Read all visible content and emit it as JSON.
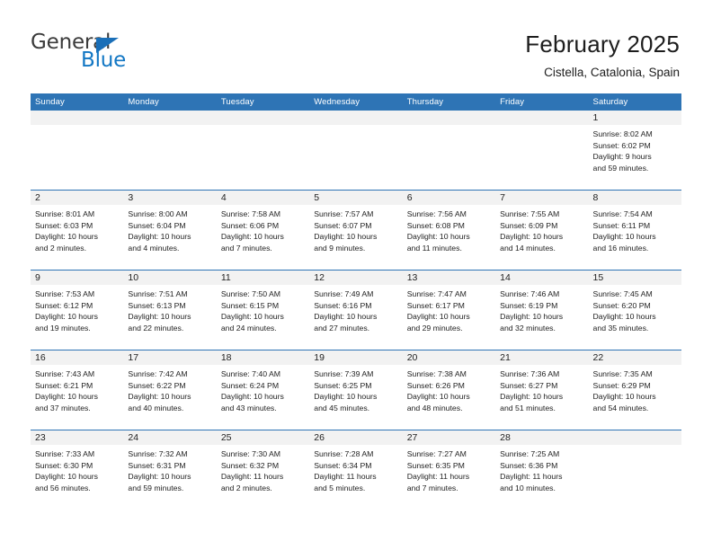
{
  "brand": {
    "name_part1": "General",
    "name_part2": "Blue",
    "triangle_color": "#1a6fb8",
    "blue_color": "#1277c4"
  },
  "header": {
    "title": "February 2025",
    "subtitle": "Cistella, Catalonia, Spain"
  },
  "theme": {
    "header_blue": "#2e74b5",
    "day_band_gray": "#f2f2f2",
    "text_color": "#222222"
  },
  "weekdays": [
    "Sunday",
    "Monday",
    "Tuesday",
    "Wednesday",
    "Thursday",
    "Friday",
    "Saturday"
  ],
  "weeks": [
    {
      "days": [
        {
          "number": "",
          "sunrise": "",
          "sunset": "",
          "daylight_line1": "",
          "daylight_line2": "",
          "empty": true
        },
        {
          "number": "",
          "sunrise": "",
          "sunset": "",
          "daylight_line1": "",
          "daylight_line2": "",
          "empty": true
        },
        {
          "number": "",
          "sunrise": "",
          "sunset": "",
          "daylight_line1": "",
          "daylight_line2": "",
          "empty": true
        },
        {
          "number": "",
          "sunrise": "",
          "sunset": "",
          "daylight_line1": "",
          "daylight_line2": "",
          "empty": true
        },
        {
          "number": "",
          "sunrise": "",
          "sunset": "",
          "daylight_line1": "",
          "daylight_line2": "",
          "empty": true
        },
        {
          "number": "",
          "sunrise": "",
          "sunset": "",
          "daylight_line1": "",
          "daylight_line2": "",
          "empty": true
        },
        {
          "number": "1",
          "sunrise": "Sunrise: 8:02 AM",
          "sunset": "Sunset: 6:02 PM",
          "daylight_line1": "Daylight: 9 hours",
          "daylight_line2": "and 59 minutes.",
          "empty": false
        }
      ]
    },
    {
      "days": [
        {
          "number": "2",
          "sunrise": "Sunrise: 8:01 AM",
          "sunset": "Sunset: 6:03 PM",
          "daylight_line1": "Daylight: 10 hours",
          "daylight_line2": "and 2 minutes.",
          "empty": false
        },
        {
          "number": "3",
          "sunrise": "Sunrise: 8:00 AM",
          "sunset": "Sunset: 6:04 PM",
          "daylight_line1": "Daylight: 10 hours",
          "daylight_line2": "and 4 minutes.",
          "empty": false
        },
        {
          "number": "4",
          "sunrise": "Sunrise: 7:58 AM",
          "sunset": "Sunset: 6:06 PM",
          "daylight_line1": "Daylight: 10 hours",
          "daylight_line2": "and 7 minutes.",
          "empty": false
        },
        {
          "number": "5",
          "sunrise": "Sunrise: 7:57 AM",
          "sunset": "Sunset: 6:07 PM",
          "daylight_line1": "Daylight: 10 hours",
          "daylight_line2": "and 9 minutes.",
          "empty": false
        },
        {
          "number": "6",
          "sunrise": "Sunrise: 7:56 AM",
          "sunset": "Sunset: 6:08 PM",
          "daylight_line1": "Daylight: 10 hours",
          "daylight_line2": "and 11 minutes.",
          "empty": false
        },
        {
          "number": "7",
          "sunrise": "Sunrise: 7:55 AM",
          "sunset": "Sunset: 6:09 PM",
          "daylight_line1": "Daylight: 10 hours",
          "daylight_line2": "and 14 minutes.",
          "empty": false
        },
        {
          "number": "8",
          "sunrise": "Sunrise: 7:54 AM",
          "sunset": "Sunset: 6:11 PM",
          "daylight_line1": "Daylight: 10 hours",
          "daylight_line2": "and 16 minutes.",
          "empty": false
        }
      ]
    },
    {
      "days": [
        {
          "number": "9",
          "sunrise": "Sunrise: 7:53 AM",
          "sunset": "Sunset: 6:12 PM",
          "daylight_line1": "Daylight: 10 hours",
          "daylight_line2": "and 19 minutes.",
          "empty": false
        },
        {
          "number": "10",
          "sunrise": "Sunrise: 7:51 AM",
          "sunset": "Sunset: 6:13 PM",
          "daylight_line1": "Daylight: 10 hours",
          "daylight_line2": "and 22 minutes.",
          "empty": false
        },
        {
          "number": "11",
          "sunrise": "Sunrise: 7:50 AM",
          "sunset": "Sunset: 6:15 PM",
          "daylight_line1": "Daylight: 10 hours",
          "daylight_line2": "and 24 minutes.",
          "empty": false
        },
        {
          "number": "12",
          "sunrise": "Sunrise: 7:49 AM",
          "sunset": "Sunset: 6:16 PM",
          "daylight_line1": "Daylight: 10 hours",
          "daylight_line2": "and 27 minutes.",
          "empty": false
        },
        {
          "number": "13",
          "sunrise": "Sunrise: 7:47 AM",
          "sunset": "Sunset: 6:17 PM",
          "daylight_line1": "Daylight: 10 hours",
          "daylight_line2": "and 29 minutes.",
          "empty": false
        },
        {
          "number": "14",
          "sunrise": "Sunrise: 7:46 AM",
          "sunset": "Sunset: 6:19 PM",
          "daylight_line1": "Daylight: 10 hours",
          "daylight_line2": "and 32 minutes.",
          "empty": false
        },
        {
          "number": "15",
          "sunrise": "Sunrise: 7:45 AM",
          "sunset": "Sunset: 6:20 PM",
          "daylight_line1": "Daylight: 10 hours",
          "daylight_line2": "and 35 minutes.",
          "empty": false
        }
      ]
    },
    {
      "days": [
        {
          "number": "16",
          "sunrise": "Sunrise: 7:43 AM",
          "sunset": "Sunset: 6:21 PM",
          "daylight_line1": "Daylight: 10 hours",
          "daylight_line2": "and 37 minutes.",
          "empty": false
        },
        {
          "number": "17",
          "sunrise": "Sunrise: 7:42 AM",
          "sunset": "Sunset: 6:22 PM",
          "daylight_line1": "Daylight: 10 hours",
          "daylight_line2": "and 40 minutes.",
          "empty": false
        },
        {
          "number": "18",
          "sunrise": "Sunrise: 7:40 AM",
          "sunset": "Sunset: 6:24 PM",
          "daylight_line1": "Daylight: 10 hours",
          "daylight_line2": "and 43 minutes.",
          "empty": false
        },
        {
          "number": "19",
          "sunrise": "Sunrise: 7:39 AM",
          "sunset": "Sunset: 6:25 PM",
          "daylight_line1": "Daylight: 10 hours",
          "daylight_line2": "and 45 minutes.",
          "empty": false
        },
        {
          "number": "20",
          "sunrise": "Sunrise: 7:38 AM",
          "sunset": "Sunset: 6:26 PM",
          "daylight_line1": "Daylight: 10 hours",
          "daylight_line2": "and 48 minutes.",
          "empty": false
        },
        {
          "number": "21",
          "sunrise": "Sunrise: 7:36 AM",
          "sunset": "Sunset: 6:27 PM",
          "daylight_line1": "Daylight: 10 hours",
          "daylight_line2": "and 51 minutes.",
          "empty": false
        },
        {
          "number": "22",
          "sunrise": "Sunrise: 7:35 AM",
          "sunset": "Sunset: 6:29 PM",
          "daylight_line1": "Daylight: 10 hours",
          "daylight_line2": "and 54 minutes.",
          "empty": false
        }
      ]
    },
    {
      "days": [
        {
          "number": "23",
          "sunrise": "Sunrise: 7:33 AM",
          "sunset": "Sunset: 6:30 PM",
          "daylight_line1": "Daylight: 10 hours",
          "daylight_line2": "and 56 minutes.",
          "empty": false
        },
        {
          "number": "24",
          "sunrise": "Sunrise: 7:32 AM",
          "sunset": "Sunset: 6:31 PM",
          "daylight_line1": "Daylight: 10 hours",
          "daylight_line2": "and 59 minutes.",
          "empty": false
        },
        {
          "number": "25",
          "sunrise": "Sunrise: 7:30 AM",
          "sunset": "Sunset: 6:32 PM",
          "daylight_line1": "Daylight: 11 hours",
          "daylight_line2": "and 2 minutes.",
          "empty": false
        },
        {
          "number": "26",
          "sunrise": "Sunrise: 7:28 AM",
          "sunset": "Sunset: 6:34 PM",
          "daylight_line1": "Daylight: 11 hours",
          "daylight_line2": "and 5 minutes.",
          "empty": false
        },
        {
          "number": "27",
          "sunrise": "Sunrise: 7:27 AM",
          "sunset": "Sunset: 6:35 PM",
          "daylight_line1": "Daylight: 11 hours",
          "daylight_line2": "and 7 minutes.",
          "empty": false
        },
        {
          "number": "28",
          "sunrise": "Sunrise: 7:25 AM",
          "sunset": "Sunset: 6:36 PM",
          "daylight_line1": "Daylight: 11 hours",
          "daylight_line2": "and 10 minutes.",
          "empty": false
        },
        {
          "number": "",
          "sunrise": "",
          "sunset": "",
          "daylight_line1": "",
          "daylight_line2": "",
          "empty": true
        }
      ]
    }
  ]
}
